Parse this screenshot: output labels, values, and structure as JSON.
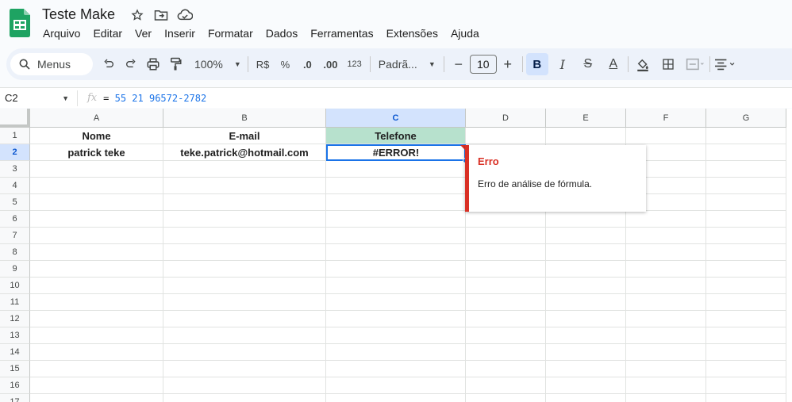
{
  "document": {
    "title": "Teste Make"
  },
  "menu": [
    "Arquivo",
    "Editar",
    "Ver",
    "Inserir",
    "Formatar",
    "Dados",
    "Ferramentas",
    "Extensões",
    "Ajuda"
  ],
  "toolbar": {
    "search_label": "Menus",
    "zoom": "100%",
    "currency": "R$",
    "percent": "%",
    "dec_decrease": ".0",
    "dec_increase": ".00",
    "number_format": "123",
    "font_name": "Padrã...",
    "font_size": "10",
    "bold": "B",
    "italic": "I",
    "strike": "S",
    "text_color": "A"
  },
  "formula_bar": {
    "cell_ref": "C2",
    "fx": "fx",
    "formula_prefix": "= ",
    "formula_num1": "55",
    "formula_num2": "21",
    "formula_rest": "96572-2782"
  },
  "columns": [
    "A",
    "B",
    "C",
    "D",
    "E",
    "F",
    "G"
  ],
  "rows": [
    "1",
    "2",
    "3",
    "4",
    "5",
    "6",
    "7",
    "8",
    "9",
    "10",
    "11",
    "12",
    "13",
    "14",
    "15",
    "16",
    "17"
  ],
  "cells": {
    "A1": "Nome",
    "B1": "E-mail",
    "C1": "Telefone",
    "A2": "patrick teke",
    "B2": "teke.patrick@hotmail.com",
    "C2": "#ERROR!"
  },
  "error_tooltip": {
    "title": "Erro",
    "message": "Erro de análise de fórmula."
  },
  "colors": {
    "accent": "#1a73e8",
    "header_fill": "#b7e1cd",
    "error": "#d93025"
  }
}
